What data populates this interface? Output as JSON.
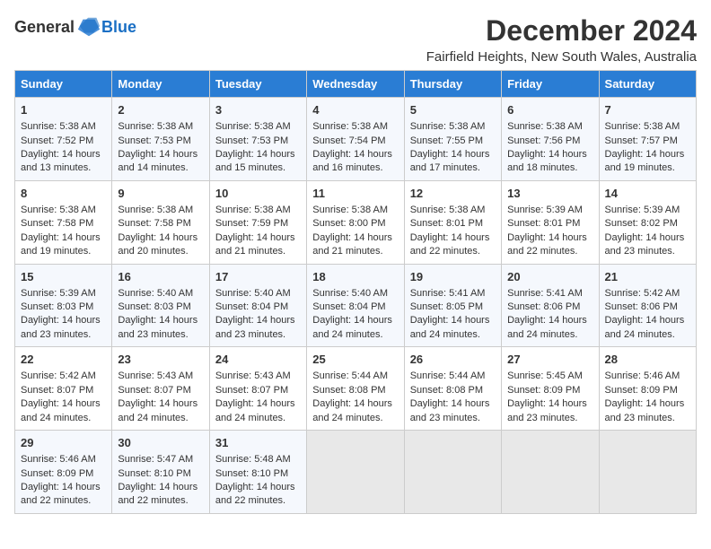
{
  "logo": {
    "general": "General",
    "blue": "Blue"
  },
  "title": "December 2024",
  "location": "Fairfield Heights, New South Wales, Australia",
  "days_of_week": [
    "Sunday",
    "Monday",
    "Tuesday",
    "Wednesday",
    "Thursday",
    "Friday",
    "Saturday"
  ],
  "weeks": [
    [
      {
        "day": "1",
        "sunrise": "5:38 AM",
        "sunset": "7:52 PM",
        "daylight": "14 hours and 13 minutes."
      },
      {
        "day": "2",
        "sunrise": "5:38 AM",
        "sunset": "7:53 PM",
        "daylight": "14 hours and 14 minutes."
      },
      {
        "day": "3",
        "sunrise": "5:38 AM",
        "sunset": "7:53 PM",
        "daylight": "14 hours and 15 minutes."
      },
      {
        "day": "4",
        "sunrise": "5:38 AM",
        "sunset": "7:54 PM",
        "daylight": "14 hours and 16 minutes."
      },
      {
        "day": "5",
        "sunrise": "5:38 AM",
        "sunset": "7:55 PM",
        "daylight": "14 hours and 17 minutes."
      },
      {
        "day": "6",
        "sunrise": "5:38 AM",
        "sunset": "7:56 PM",
        "daylight": "14 hours and 18 minutes."
      },
      {
        "day": "7",
        "sunrise": "5:38 AM",
        "sunset": "7:57 PM",
        "daylight": "14 hours and 19 minutes."
      }
    ],
    [
      {
        "day": "8",
        "sunrise": "5:38 AM",
        "sunset": "7:58 PM",
        "daylight": "14 hours and 19 minutes."
      },
      {
        "day": "9",
        "sunrise": "5:38 AM",
        "sunset": "7:58 PM",
        "daylight": "14 hours and 20 minutes."
      },
      {
        "day": "10",
        "sunrise": "5:38 AM",
        "sunset": "7:59 PM",
        "daylight": "14 hours and 21 minutes."
      },
      {
        "day": "11",
        "sunrise": "5:38 AM",
        "sunset": "8:00 PM",
        "daylight": "14 hours and 21 minutes."
      },
      {
        "day": "12",
        "sunrise": "5:38 AM",
        "sunset": "8:01 PM",
        "daylight": "14 hours and 22 minutes."
      },
      {
        "day": "13",
        "sunrise": "5:39 AM",
        "sunset": "8:01 PM",
        "daylight": "14 hours and 22 minutes."
      },
      {
        "day": "14",
        "sunrise": "5:39 AM",
        "sunset": "8:02 PM",
        "daylight": "14 hours and 23 minutes."
      }
    ],
    [
      {
        "day": "15",
        "sunrise": "5:39 AM",
        "sunset": "8:03 PM",
        "daylight": "14 hours and 23 minutes."
      },
      {
        "day": "16",
        "sunrise": "5:40 AM",
        "sunset": "8:03 PM",
        "daylight": "14 hours and 23 minutes."
      },
      {
        "day": "17",
        "sunrise": "5:40 AM",
        "sunset": "8:04 PM",
        "daylight": "14 hours and 23 minutes."
      },
      {
        "day": "18",
        "sunrise": "5:40 AM",
        "sunset": "8:04 PM",
        "daylight": "14 hours and 24 minutes."
      },
      {
        "day": "19",
        "sunrise": "5:41 AM",
        "sunset": "8:05 PM",
        "daylight": "14 hours and 24 minutes."
      },
      {
        "day": "20",
        "sunrise": "5:41 AM",
        "sunset": "8:06 PM",
        "daylight": "14 hours and 24 minutes."
      },
      {
        "day": "21",
        "sunrise": "5:42 AM",
        "sunset": "8:06 PM",
        "daylight": "14 hours and 24 minutes."
      }
    ],
    [
      {
        "day": "22",
        "sunrise": "5:42 AM",
        "sunset": "8:07 PM",
        "daylight": "14 hours and 24 minutes."
      },
      {
        "day": "23",
        "sunrise": "5:43 AM",
        "sunset": "8:07 PM",
        "daylight": "14 hours and 24 minutes."
      },
      {
        "day": "24",
        "sunrise": "5:43 AM",
        "sunset": "8:07 PM",
        "daylight": "14 hours and 24 minutes."
      },
      {
        "day": "25",
        "sunrise": "5:44 AM",
        "sunset": "8:08 PM",
        "daylight": "14 hours and 24 minutes."
      },
      {
        "day": "26",
        "sunrise": "5:44 AM",
        "sunset": "8:08 PM",
        "daylight": "14 hours and 23 minutes."
      },
      {
        "day": "27",
        "sunrise": "5:45 AM",
        "sunset": "8:09 PM",
        "daylight": "14 hours and 23 minutes."
      },
      {
        "day": "28",
        "sunrise": "5:46 AM",
        "sunset": "8:09 PM",
        "daylight": "14 hours and 23 minutes."
      }
    ],
    [
      {
        "day": "29",
        "sunrise": "5:46 AM",
        "sunset": "8:09 PM",
        "daylight": "14 hours and 22 minutes."
      },
      {
        "day": "30",
        "sunrise": "5:47 AM",
        "sunset": "8:10 PM",
        "daylight": "14 hours and 22 minutes."
      },
      {
        "day": "31",
        "sunrise": "5:48 AM",
        "sunset": "8:10 PM",
        "daylight": "14 hours and 22 minutes."
      },
      null,
      null,
      null,
      null
    ]
  ]
}
